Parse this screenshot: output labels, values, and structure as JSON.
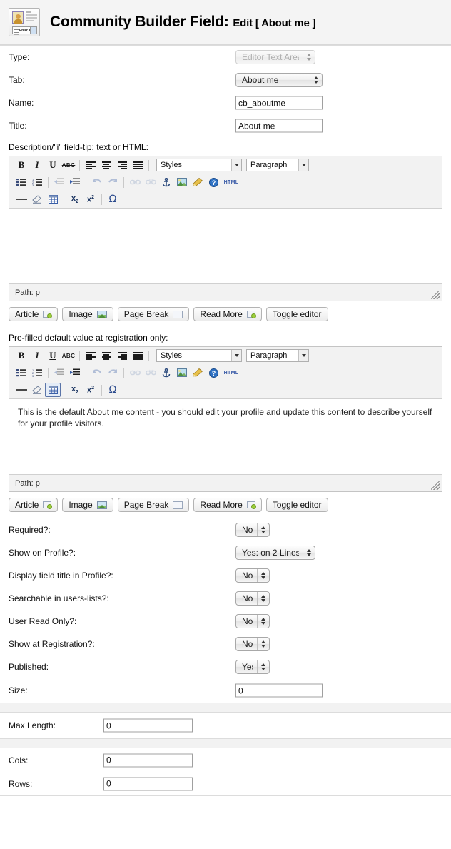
{
  "header": {
    "icon": "cb-field-form-icon",
    "title": "Community Builder Field:",
    "subtitle": "Edit [ About me ]"
  },
  "form": {
    "type": {
      "label": "Type:",
      "value": "Editor Text Area",
      "disabled": true
    },
    "tab": {
      "label": "Tab:",
      "value": "About me"
    },
    "name": {
      "label": "Name:",
      "value": "cb_aboutme"
    },
    "title": {
      "label": "Title:",
      "value": "About me"
    },
    "description_label": "Description/\"i\" field-tip: text or HTML:",
    "prefilled_label": "Pre-filled default value at registration only:",
    "required": {
      "label": "Required?:",
      "value": "No"
    },
    "show_on_profile": {
      "label": "Show on Profile?:",
      "value": "Yes: on 2 Lines"
    },
    "display_title": {
      "label": "Display field title in Profile?:",
      "value": "No"
    },
    "searchable": {
      "label": "Searchable in users-lists?:",
      "value": "No"
    },
    "user_read_only": {
      "label": "User Read Only?:",
      "value": "No"
    },
    "show_at_registration": {
      "label": "Show at Registration?:",
      "value": "No"
    },
    "published": {
      "label": "Published:",
      "value": "Yes"
    },
    "size": {
      "label": "Size:",
      "value": "0"
    },
    "max_length": {
      "label": "Max Length:",
      "value": "0"
    },
    "cols": {
      "label": "Cols:",
      "value": "0"
    },
    "rows": {
      "label": "Rows:",
      "value": "0"
    }
  },
  "editor": {
    "styles_select": "Styles",
    "format_select": "Paragraph",
    "status_path": "Path: p",
    "html_button": "HTML",
    "toolbar_row1": [
      {
        "name": "bold-icon",
        "glyph": "B"
      },
      {
        "name": "italic-icon",
        "glyph": "I"
      },
      {
        "name": "underline-icon",
        "glyph": "U"
      },
      {
        "name": "strikethrough-icon",
        "glyph": "ABC"
      },
      {
        "name": "align-left-icon",
        "glyph": ""
      },
      {
        "name": "align-center-icon",
        "glyph": ""
      },
      {
        "name": "align-right-icon",
        "glyph": ""
      },
      {
        "name": "align-justify-icon",
        "glyph": ""
      }
    ],
    "toolbar_row2": [
      {
        "name": "bullet-list-icon"
      },
      {
        "name": "numbered-list-icon"
      },
      {
        "name": "outdent-icon"
      },
      {
        "name": "indent-icon"
      },
      {
        "name": "undo-icon"
      },
      {
        "name": "redo-icon"
      },
      {
        "name": "link-icon"
      },
      {
        "name": "unlink-icon"
      },
      {
        "name": "anchor-icon"
      },
      {
        "name": "insert-image-icon"
      },
      {
        "name": "cleanup-icon"
      },
      {
        "name": "help-icon"
      },
      {
        "name": "edit-html-icon"
      }
    ],
    "toolbar_row3": [
      {
        "name": "horizontal-rule-icon"
      },
      {
        "name": "remove-format-icon"
      },
      {
        "name": "insert-table-icon"
      },
      {
        "name": "subscript-icon"
      },
      {
        "name": "superscript-icon"
      },
      {
        "name": "special-character-icon"
      }
    ],
    "description_content": "",
    "prefilled_content": "This is the default About me content - you should edit your profile and update this content to describe yourself for your profile visitors."
  },
  "joomla_buttons": [
    {
      "label": "Article",
      "icon": "article-icon"
    },
    {
      "label": "Image",
      "icon": "image-icon"
    },
    {
      "label": "Page Break",
      "icon": "page-break-icon"
    },
    {
      "label": "Read More",
      "icon": "read-more-icon"
    },
    {
      "label": "Toggle editor",
      "icon": ""
    }
  ]
}
